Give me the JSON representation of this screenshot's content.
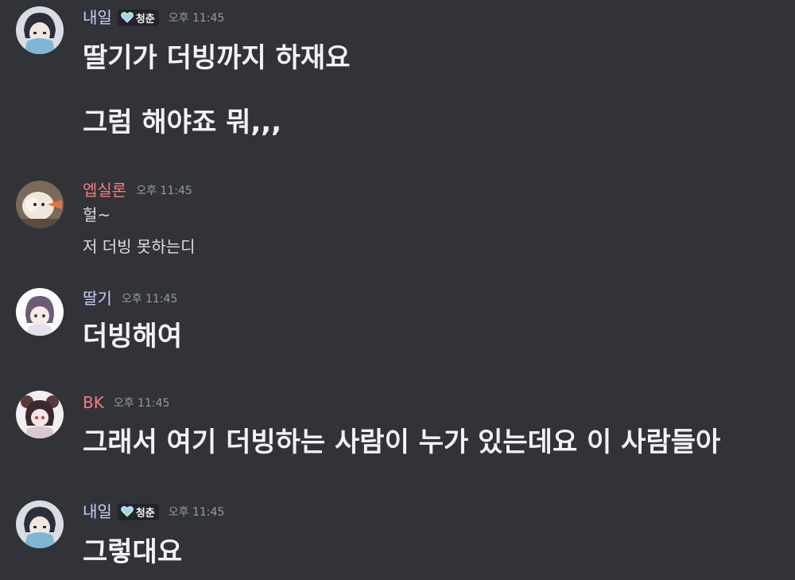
{
  "messages": [
    {
      "username": "내일",
      "username_color": "#c9cdfb",
      "badge": {
        "label": "청춘",
        "icon": "heart-icon"
      },
      "time": "오후 11:45",
      "lines": [
        "딸기가 더빙까지 하재요",
        "그럼 해야죠 뭐,,,"
      ]
    },
    {
      "username": "엡실론",
      "username_color": "#f47c7c",
      "time": "오후 11:45",
      "lines": [
        "헐~",
        "저 더빙 못하는디"
      ]
    },
    {
      "username": "딸기",
      "username_color": "#c9cdfb",
      "time": "오후 11:45",
      "lines": [
        "더빙해여"
      ]
    },
    {
      "username": "BK",
      "username_color": "#f47c7c",
      "time": "오후 11:45",
      "lines": [
        "그래서 여기 더빙하는 사람이 누가 있는데요 이 사람들아"
      ]
    },
    {
      "username": "내일",
      "username_color": "#c9cdfb",
      "badge": {
        "label": "청춘",
        "icon": "heart-icon"
      },
      "time": "오후 11:45",
      "lines": [
        "그렇대요"
      ]
    }
  ]
}
